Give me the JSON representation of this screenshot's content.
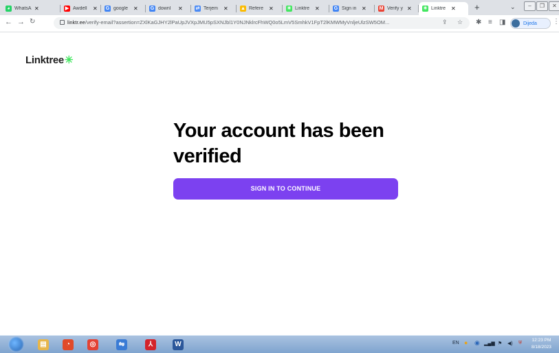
{
  "browser": {
    "tabs": [
      {
        "label": "WhatsA",
        "icon": "whatsapp-icon",
        "color": "#25d366",
        "active": false
      },
      {
        "label": "Awdell",
        "icon": "youtube-icon",
        "color": "#ff0000",
        "active": false
      },
      {
        "label": "google",
        "icon": "google-icon",
        "color": "#4285f4",
        "active": false
      },
      {
        "label": "downl",
        "icon": "google-icon",
        "color": "#4285f4",
        "active": false
      },
      {
        "label": "Terjem",
        "icon": "translate-icon",
        "color": "#4a8af4",
        "active": false
      },
      {
        "label": "Refere",
        "icon": "drive-icon",
        "color": "#fbbc04",
        "active": false
      },
      {
        "label": "Linktre",
        "icon": "linktree-icon",
        "color": "#43e660",
        "active": false
      },
      {
        "label": "Sign in",
        "icon": "google-icon",
        "color": "#4285f4",
        "active": false
      },
      {
        "label": "Verify y",
        "icon": "gmail-icon",
        "color": "#ea4335",
        "active": false
      },
      {
        "label": "Linktre",
        "icon": "linktree-icon",
        "color": "#43e660",
        "active": true
      }
    ],
    "url_host": "linktr.ee",
    "url_path": "/verify-email?assertion=ZXlKaGJHY2lPaUpJVXpJMU5pSXNJbl1Y0NJNklrcFhWQ0o5LmV5SmhkV1FpT2lKMWMyVnljeUlzSW5OM...",
    "profile_name": "Dijeda"
  },
  "page": {
    "logo_text": "Linktree",
    "logo_mark": "✳",
    "heading": "Your account has been verified",
    "button_label": "SIGN IN TO CONTINUE",
    "accent_color": "#7c41f0"
  },
  "taskbar": {
    "apps": [
      {
        "icon": "file-explorer-icon",
        "color": "#e8b64a"
      },
      {
        "icon": "app-icon",
        "color": "#e04a2a"
      },
      {
        "icon": "chrome-icon",
        "color": "#e34234"
      },
      {
        "icon": "network-icon",
        "color": "#3a7bd5"
      },
      {
        "icon": "acrobat-icon",
        "color": "#d3232a"
      },
      {
        "icon": "word-icon",
        "color": "#2b579a"
      }
    ],
    "language": "EN",
    "time": "12:23 PM",
    "date": "8/18/2023"
  }
}
